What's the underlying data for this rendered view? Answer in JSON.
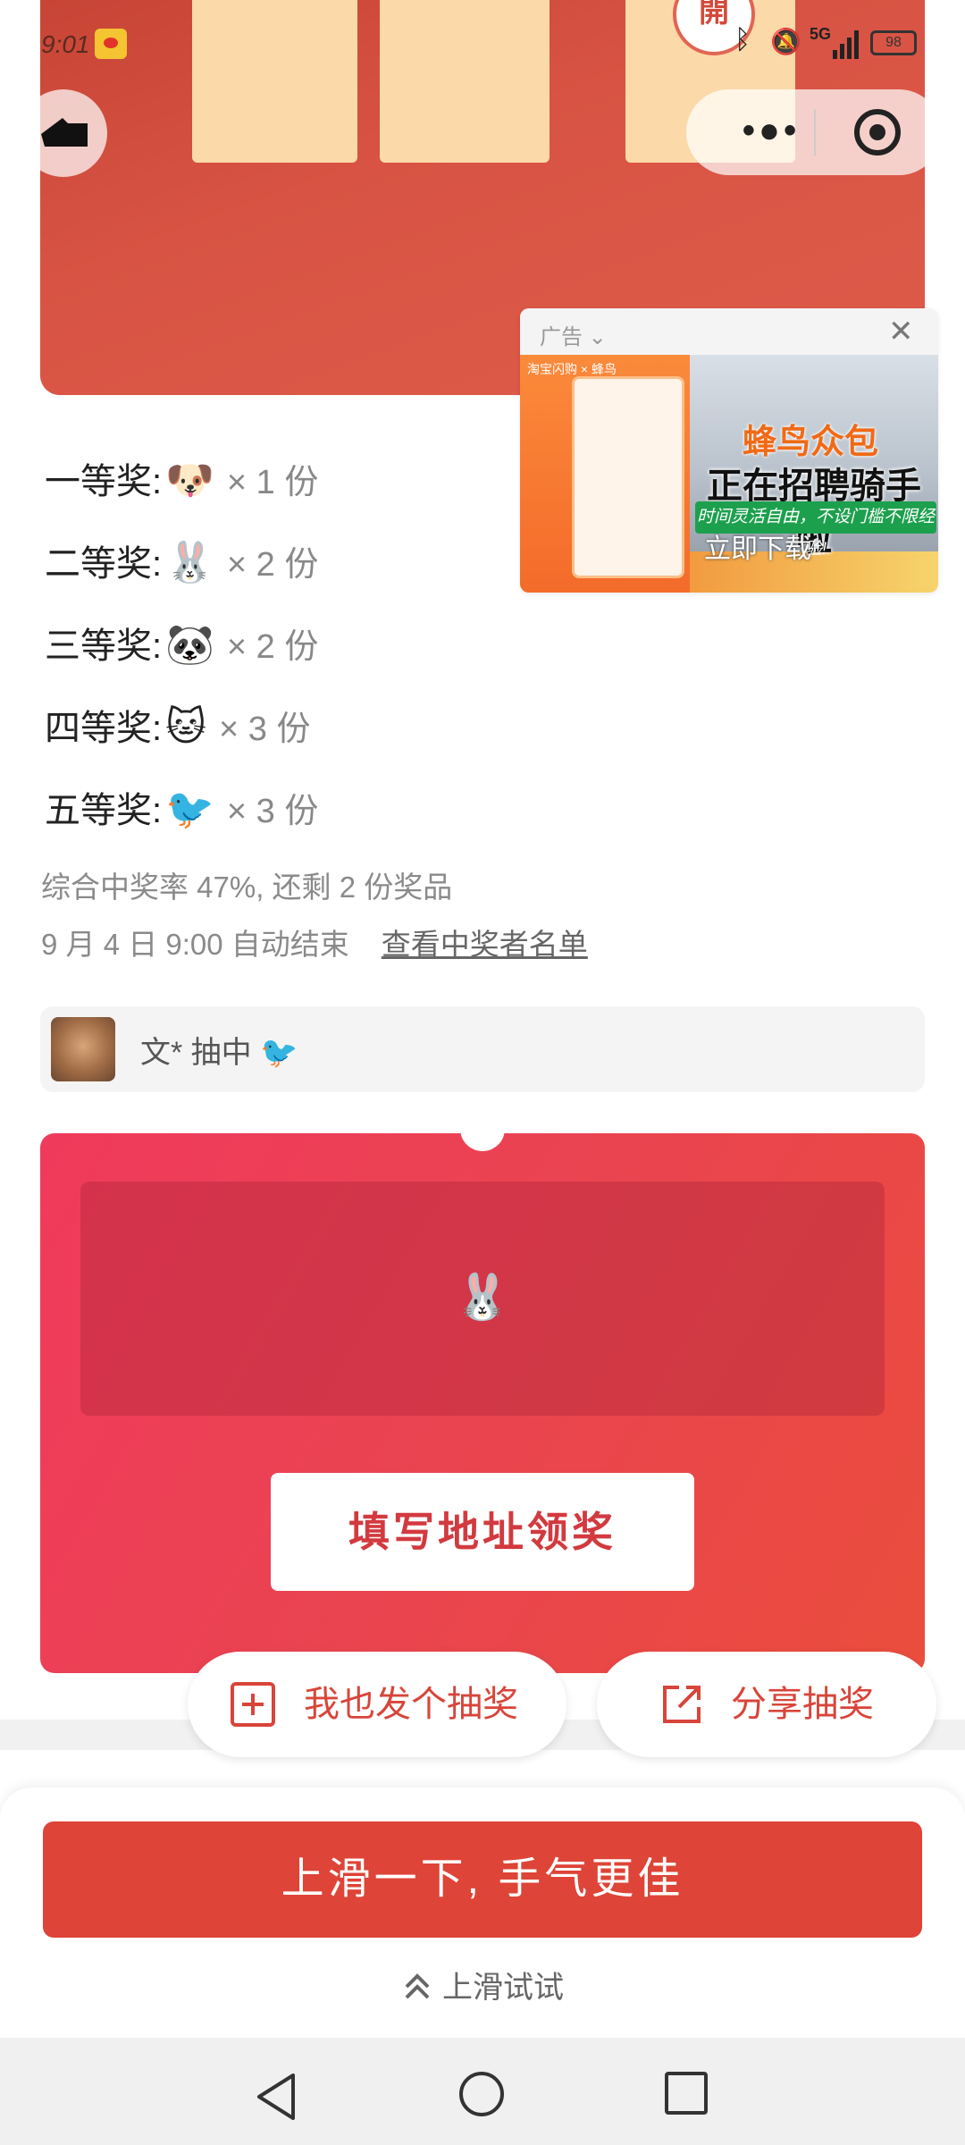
{
  "status_bar": {
    "time": "9:01",
    "network": "5G",
    "battery": "98",
    "icons": [
      "weibo-icon",
      "bluetooth-icon",
      "mute-icon",
      "signal-icon",
      "battery-icon"
    ]
  },
  "banner": {
    "open_badge": "開"
  },
  "capsule": {
    "more_symbol": "•●•"
  },
  "ad": {
    "label": "广告",
    "close_symbol": "✕",
    "brand_text": "淘宝闪购 × 蜂鸟",
    "headline_orange": "蜂鸟众包",
    "headline_black": "正在招聘骑手啦",
    "green_banner": "时间灵活自由，不设门槛不限经验!",
    "cta": "立即下载"
  },
  "prizes": [
    {
      "label": "一等奖:",
      "emoji": "🐶",
      "count": "× 1 份"
    },
    {
      "label": "二等奖:",
      "emoji": "🐰",
      "count": "× 2 份"
    },
    {
      "label": "三等奖:",
      "emoji": "🐼",
      "count": "× 2 份"
    },
    {
      "label": "四等奖:",
      "emoji": "🐱",
      "count": "× 3 份"
    },
    {
      "label": "五等奖:",
      "emoji": "🐦",
      "count": "× 3 份"
    }
  ],
  "summary": {
    "rate_text": "综合中奖率 47%, 还剩 2 份奖品",
    "end_text": "9 月 4 日 9:00 自动结束",
    "winners_link": "查看中奖者名单"
  },
  "winner_row": {
    "text": "文* 抽中 🐦"
  },
  "result": {
    "prize_emoji": "🐰",
    "claim_button": "填写地址领奖"
  },
  "actions": {
    "create_lottery": "我也发个抽奖",
    "share_lottery": "分享抽奖"
  },
  "bottom_sheet": {
    "main_button": "上滑一下, 手气更佳",
    "swipe_hint": "上滑试试"
  },
  "colors": {
    "banner_red": "#d65040",
    "card_beige": "#fbd9a9",
    "accent_red": "#de4437",
    "gradient_pink": "#f03a5c"
  }
}
